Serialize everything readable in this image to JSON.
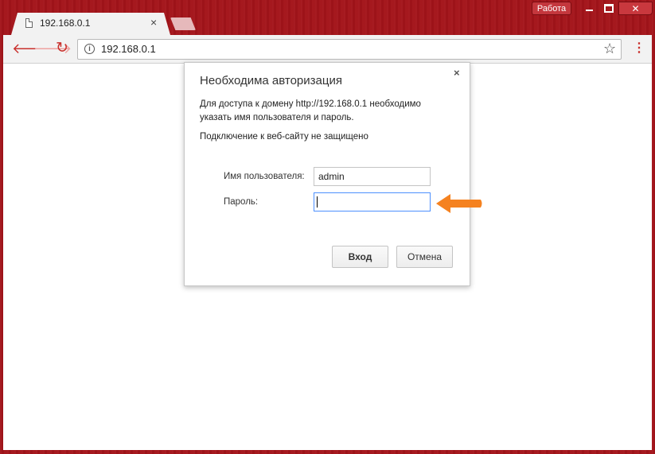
{
  "browser": {
    "tab_title": "192.168.0.1",
    "tab_close": "×",
    "profile_label": "Работа",
    "url": "192.168.0.1"
  },
  "icons": {
    "back": "arrow-left-icon",
    "forward": "arrow-right-icon",
    "reload": "reload-icon",
    "info": "info-icon",
    "star": "star-icon",
    "menu": "kebab-menu-icon"
  },
  "dialog": {
    "title": "Необходима авторизация",
    "close": "×",
    "message_line1": "Для доступа к домену http://192.168.0.1 необходимо",
    "message_line2": "указать имя пользователя и пароль.",
    "security_note": "Подключение к веб-сайту не защищено",
    "username_label": "Имя пользователя:",
    "username_value": "admin",
    "password_label": "Пароль:",
    "password_value": "",
    "login_button": "Вход",
    "cancel_button": "Отмена"
  },
  "colors": {
    "frame": "#a3141a",
    "accent": "#c9302c",
    "arrow": "#f58220",
    "focus": "#4d90fe"
  }
}
